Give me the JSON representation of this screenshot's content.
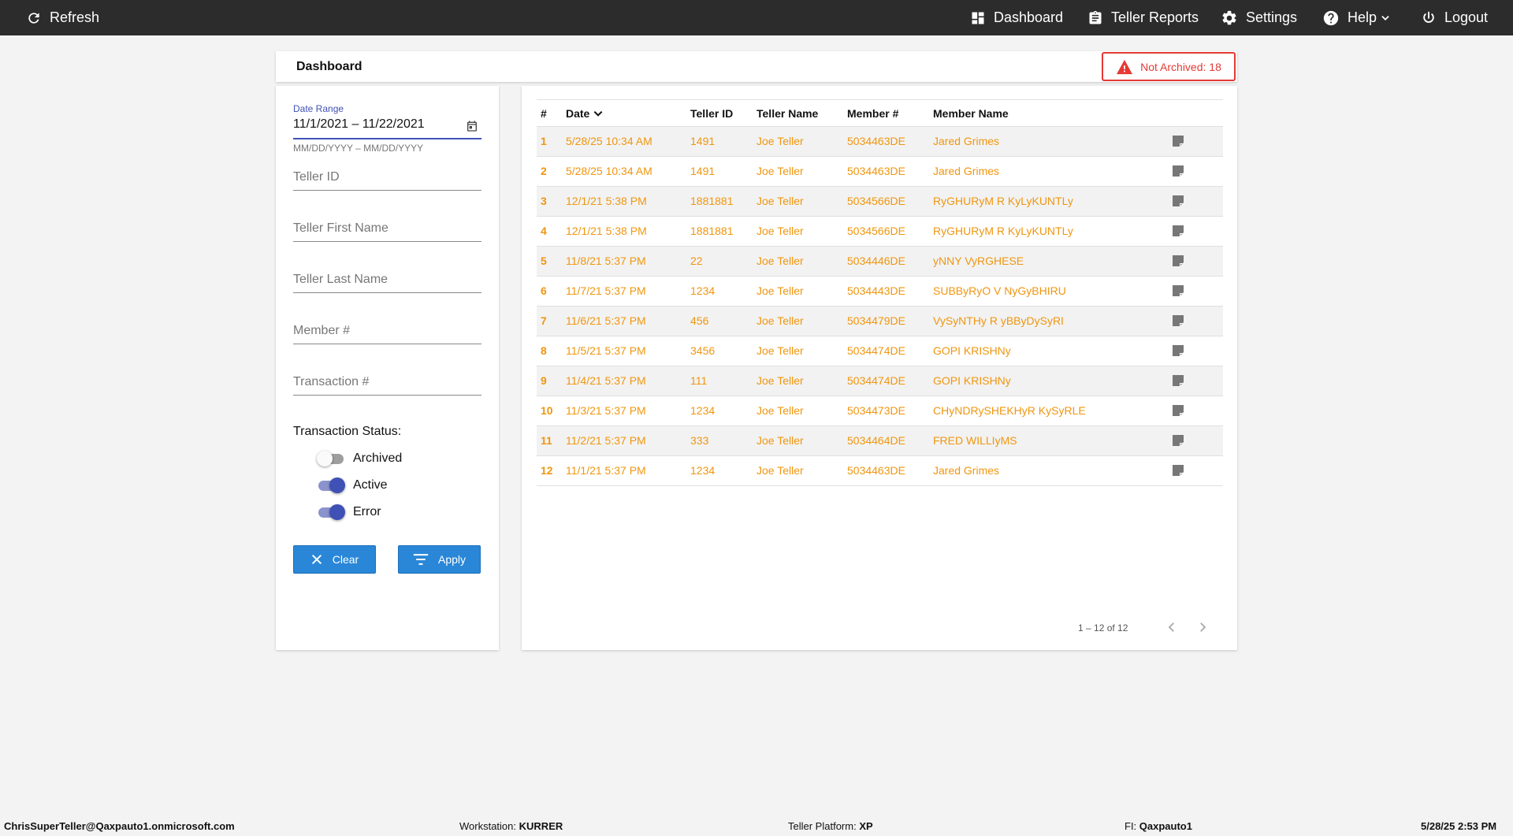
{
  "topbar": {
    "refresh": "Refresh",
    "dashboard": "Dashboard",
    "teller_reports": "Teller Reports",
    "settings": "Settings",
    "help": "Help",
    "logout": "Logout"
  },
  "header": {
    "title": "Dashboard",
    "badge": "Not Archived: 18"
  },
  "filters": {
    "date_range_label": "Date Range",
    "date_range_value": "11/1/2021 – 11/22/2021",
    "date_hint": "MM/DD/YYYY – MM/DD/YYYY",
    "teller_id_placeholder": "Teller ID",
    "teller_first_name_placeholder": "Teller First Name",
    "teller_last_name_placeholder": "Teller Last Name",
    "member_num_placeholder": "Member #",
    "transaction_num_placeholder": "Transaction #",
    "status_title": "Transaction Status:",
    "archived": "Archived",
    "active": "Active",
    "error": "Error",
    "clear": "Clear",
    "apply": "Apply"
  },
  "table": {
    "headers": {
      "num": "#",
      "date": "Date",
      "teller_id": "Teller ID",
      "teller_name": "Teller Name",
      "member_num": "Member #",
      "member_name": "Member Name"
    },
    "rows": [
      {
        "num": "1",
        "date": "5/28/25 10:34 AM",
        "teller_id": "1491",
        "teller_name": "Joe Teller",
        "member_num": "5034463DE",
        "member_name": "Jared Grimes"
      },
      {
        "num": "2",
        "date": "5/28/25 10:34 AM",
        "teller_id": "1491",
        "teller_name": "Joe Teller",
        "member_num": "5034463DE",
        "member_name": "Jared Grimes"
      },
      {
        "num": "3",
        "date": "12/1/21 5:38 PM",
        "teller_id": "1881881",
        "teller_name": "Joe Teller",
        "member_num": "5034566DE",
        "member_name": "RyGHURyM R KyLyKUNTLy"
      },
      {
        "num": "4",
        "date": "12/1/21 5:38 PM",
        "teller_id": "1881881",
        "teller_name": "Joe Teller",
        "member_num": "5034566DE",
        "member_name": "RyGHURyM R KyLyKUNTLy"
      },
      {
        "num": "5",
        "date": "11/8/21 5:37 PM",
        "teller_id": "22",
        "teller_name": "Joe Teller",
        "member_num": "5034446DE",
        "member_name": "yNNY VyRGHESE"
      },
      {
        "num": "6",
        "date": "11/7/21 5:37 PM",
        "teller_id": "1234",
        "teller_name": "Joe Teller",
        "member_num": "5034443DE",
        "member_name": "SUBByRyO V NyGyBHIRU"
      },
      {
        "num": "7",
        "date": "11/6/21 5:37 PM",
        "teller_id": "456",
        "teller_name": "Joe Teller",
        "member_num": "5034479DE",
        "member_name": "VySyNTHy R yBByDySyRI"
      },
      {
        "num": "8",
        "date": "11/5/21 5:37 PM",
        "teller_id": "3456",
        "teller_name": "Joe Teller",
        "member_num": "5034474DE",
        "member_name": "GOPI KRISHNy"
      },
      {
        "num": "9",
        "date": "11/4/21 5:37 PM",
        "teller_id": "111",
        "teller_name": "Joe Teller",
        "member_num": "5034474DE",
        "member_name": "GOPI KRISHNy"
      },
      {
        "num": "10",
        "date": "11/3/21 5:37 PM",
        "teller_id": "1234",
        "teller_name": "Joe Teller",
        "member_num": "5034473DE",
        "member_name": "CHyNDRySHEKHyR KySyRLE"
      },
      {
        "num": "11",
        "date": "11/2/21 5:37 PM",
        "teller_id": "333",
        "teller_name": "Joe Teller",
        "member_num": "5034464DE",
        "member_name": "FRED WILLIyMS"
      },
      {
        "num": "12",
        "date": "11/1/21 5:37 PM",
        "teller_id": "1234",
        "teller_name": "Joe Teller",
        "member_num": "5034463DE",
        "member_name": "Jared Grimes"
      }
    ],
    "pager": "1 – 12 of 12"
  },
  "footer": {
    "user": "ChrisSuperTeller@Qaxpauto1.onmicrosoft.com",
    "workstation_label": "Workstation:",
    "workstation": "KURRER",
    "platform_label": "Teller Platform:",
    "platform": "XP",
    "fi_label": "FI:",
    "fi": "Qaxpauto1",
    "datetime": "5/28/25 2:53 PM"
  },
  "colors": {
    "accent": "#3f51b5",
    "row_text": "#f0960f",
    "alert": "#e53935",
    "button": "#2a87d8",
    "topbar": "#2c2c2c"
  },
  "icons": [
    "refresh-icon",
    "dashboard-icon",
    "clipboard-icon",
    "gear-icon",
    "help-icon",
    "chevron-down-icon",
    "power-icon",
    "warning-icon",
    "calendar-icon",
    "close-icon",
    "filter-icon",
    "sort-down-icon",
    "note-icon",
    "chevron-left-icon",
    "chevron-right-icon"
  ]
}
